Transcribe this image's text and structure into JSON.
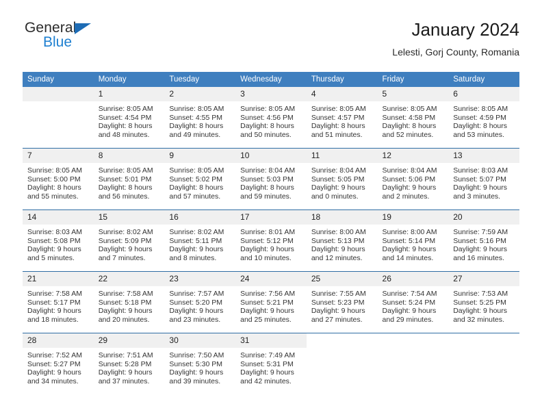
{
  "logo": {
    "word1": "General",
    "word2": "Blue",
    "triangle_color": "#1e6cb5",
    "blue_color": "#1d7fd0"
  },
  "header": {
    "title": "January 2024",
    "location": "Lelesti, Gorj County, Romania"
  },
  "theme": {
    "header_bg": "#3f7fbf",
    "row_separator": "#2e6da4",
    "daynum_bg": "#f0f0f0"
  },
  "weekdays": [
    "Sunday",
    "Monday",
    "Tuesday",
    "Wednesday",
    "Thursday",
    "Friday",
    "Saturday"
  ],
  "weeks": [
    [
      {
        "day": "",
        "sunrise": "",
        "sunset": "",
        "daylight1": "",
        "daylight2": ""
      },
      {
        "day": "1",
        "sunrise": "Sunrise: 8:05 AM",
        "sunset": "Sunset: 4:54 PM",
        "daylight1": "Daylight: 8 hours",
        "daylight2": "and 48 minutes."
      },
      {
        "day": "2",
        "sunrise": "Sunrise: 8:05 AM",
        "sunset": "Sunset: 4:55 PM",
        "daylight1": "Daylight: 8 hours",
        "daylight2": "and 49 minutes."
      },
      {
        "day": "3",
        "sunrise": "Sunrise: 8:05 AM",
        "sunset": "Sunset: 4:56 PM",
        "daylight1": "Daylight: 8 hours",
        "daylight2": "and 50 minutes."
      },
      {
        "day": "4",
        "sunrise": "Sunrise: 8:05 AM",
        "sunset": "Sunset: 4:57 PM",
        "daylight1": "Daylight: 8 hours",
        "daylight2": "and 51 minutes."
      },
      {
        "day": "5",
        "sunrise": "Sunrise: 8:05 AM",
        "sunset": "Sunset: 4:58 PM",
        "daylight1": "Daylight: 8 hours",
        "daylight2": "and 52 minutes."
      },
      {
        "day": "6",
        "sunrise": "Sunrise: 8:05 AM",
        "sunset": "Sunset: 4:59 PM",
        "daylight1": "Daylight: 8 hours",
        "daylight2": "and 53 minutes."
      }
    ],
    [
      {
        "day": "7",
        "sunrise": "Sunrise: 8:05 AM",
        "sunset": "Sunset: 5:00 PM",
        "daylight1": "Daylight: 8 hours",
        "daylight2": "and 55 minutes."
      },
      {
        "day": "8",
        "sunrise": "Sunrise: 8:05 AM",
        "sunset": "Sunset: 5:01 PM",
        "daylight1": "Daylight: 8 hours",
        "daylight2": "and 56 minutes."
      },
      {
        "day": "9",
        "sunrise": "Sunrise: 8:05 AM",
        "sunset": "Sunset: 5:02 PM",
        "daylight1": "Daylight: 8 hours",
        "daylight2": "and 57 minutes."
      },
      {
        "day": "10",
        "sunrise": "Sunrise: 8:04 AM",
        "sunset": "Sunset: 5:03 PM",
        "daylight1": "Daylight: 8 hours",
        "daylight2": "and 59 minutes."
      },
      {
        "day": "11",
        "sunrise": "Sunrise: 8:04 AM",
        "sunset": "Sunset: 5:05 PM",
        "daylight1": "Daylight: 9 hours",
        "daylight2": "and 0 minutes."
      },
      {
        "day": "12",
        "sunrise": "Sunrise: 8:04 AM",
        "sunset": "Sunset: 5:06 PM",
        "daylight1": "Daylight: 9 hours",
        "daylight2": "and 2 minutes."
      },
      {
        "day": "13",
        "sunrise": "Sunrise: 8:03 AM",
        "sunset": "Sunset: 5:07 PM",
        "daylight1": "Daylight: 9 hours",
        "daylight2": "and 3 minutes."
      }
    ],
    [
      {
        "day": "14",
        "sunrise": "Sunrise: 8:03 AM",
        "sunset": "Sunset: 5:08 PM",
        "daylight1": "Daylight: 9 hours",
        "daylight2": "and 5 minutes."
      },
      {
        "day": "15",
        "sunrise": "Sunrise: 8:02 AM",
        "sunset": "Sunset: 5:09 PM",
        "daylight1": "Daylight: 9 hours",
        "daylight2": "and 7 minutes."
      },
      {
        "day": "16",
        "sunrise": "Sunrise: 8:02 AM",
        "sunset": "Sunset: 5:11 PM",
        "daylight1": "Daylight: 9 hours",
        "daylight2": "and 8 minutes."
      },
      {
        "day": "17",
        "sunrise": "Sunrise: 8:01 AM",
        "sunset": "Sunset: 5:12 PM",
        "daylight1": "Daylight: 9 hours",
        "daylight2": "and 10 minutes."
      },
      {
        "day": "18",
        "sunrise": "Sunrise: 8:00 AM",
        "sunset": "Sunset: 5:13 PM",
        "daylight1": "Daylight: 9 hours",
        "daylight2": "and 12 minutes."
      },
      {
        "day": "19",
        "sunrise": "Sunrise: 8:00 AM",
        "sunset": "Sunset: 5:14 PM",
        "daylight1": "Daylight: 9 hours",
        "daylight2": "and 14 minutes."
      },
      {
        "day": "20",
        "sunrise": "Sunrise: 7:59 AM",
        "sunset": "Sunset: 5:16 PM",
        "daylight1": "Daylight: 9 hours",
        "daylight2": "and 16 minutes."
      }
    ],
    [
      {
        "day": "21",
        "sunrise": "Sunrise: 7:58 AM",
        "sunset": "Sunset: 5:17 PM",
        "daylight1": "Daylight: 9 hours",
        "daylight2": "and 18 minutes."
      },
      {
        "day": "22",
        "sunrise": "Sunrise: 7:58 AM",
        "sunset": "Sunset: 5:18 PM",
        "daylight1": "Daylight: 9 hours",
        "daylight2": "and 20 minutes."
      },
      {
        "day": "23",
        "sunrise": "Sunrise: 7:57 AM",
        "sunset": "Sunset: 5:20 PM",
        "daylight1": "Daylight: 9 hours",
        "daylight2": "and 23 minutes."
      },
      {
        "day": "24",
        "sunrise": "Sunrise: 7:56 AM",
        "sunset": "Sunset: 5:21 PM",
        "daylight1": "Daylight: 9 hours",
        "daylight2": "and 25 minutes."
      },
      {
        "day": "25",
        "sunrise": "Sunrise: 7:55 AM",
        "sunset": "Sunset: 5:23 PM",
        "daylight1": "Daylight: 9 hours",
        "daylight2": "and 27 minutes."
      },
      {
        "day": "26",
        "sunrise": "Sunrise: 7:54 AM",
        "sunset": "Sunset: 5:24 PM",
        "daylight1": "Daylight: 9 hours",
        "daylight2": "and 29 minutes."
      },
      {
        "day": "27",
        "sunrise": "Sunrise: 7:53 AM",
        "sunset": "Sunset: 5:25 PM",
        "daylight1": "Daylight: 9 hours",
        "daylight2": "and 32 minutes."
      }
    ],
    [
      {
        "day": "28",
        "sunrise": "Sunrise: 7:52 AM",
        "sunset": "Sunset: 5:27 PM",
        "daylight1": "Daylight: 9 hours",
        "daylight2": "and 34 minutes."
      },
      {
        "day": "29",
        "sunrise": "Sunrise: 7:51 AM",
        "sunset": "Sunset: 5:28 PM",
        "daylight1": "Daylight: 9 hours",
        "daylight2": "and 37 minutes."
      },
      {
        "day": "30",
        "sunrise": "Sunrise: 7:50 AM",
        "sunset": "Sunset: 5:30 PM",
        "daylight1": "Daylight: 9 hours",
        "daylight2": "and 39 minutes."
      },
      {
        "day": "31",
        "sunrise": "Sunrise: 7:49 AM",
        "sunset": "Sunset: 5:31 PM",
        "daylight1": "Daylight: 9 hours",
        "daylight2": "and 42 minutes."
      },
      {
        "day": "",
        "sunrise": "",
        "sunset": "",
        "daylight1": "",
        "daylight2": ""
      },
      {
        "day": "",
        "sunrise": "",
        "sunset": "",
        "daylight1": "",
        "daylight2": ""
      },
      {
        "day": "",
        "sunrise": "",
        "sunset": "",
        "daylight1": "",
        "daylight2": ""
      }
    ]
  ]
}
